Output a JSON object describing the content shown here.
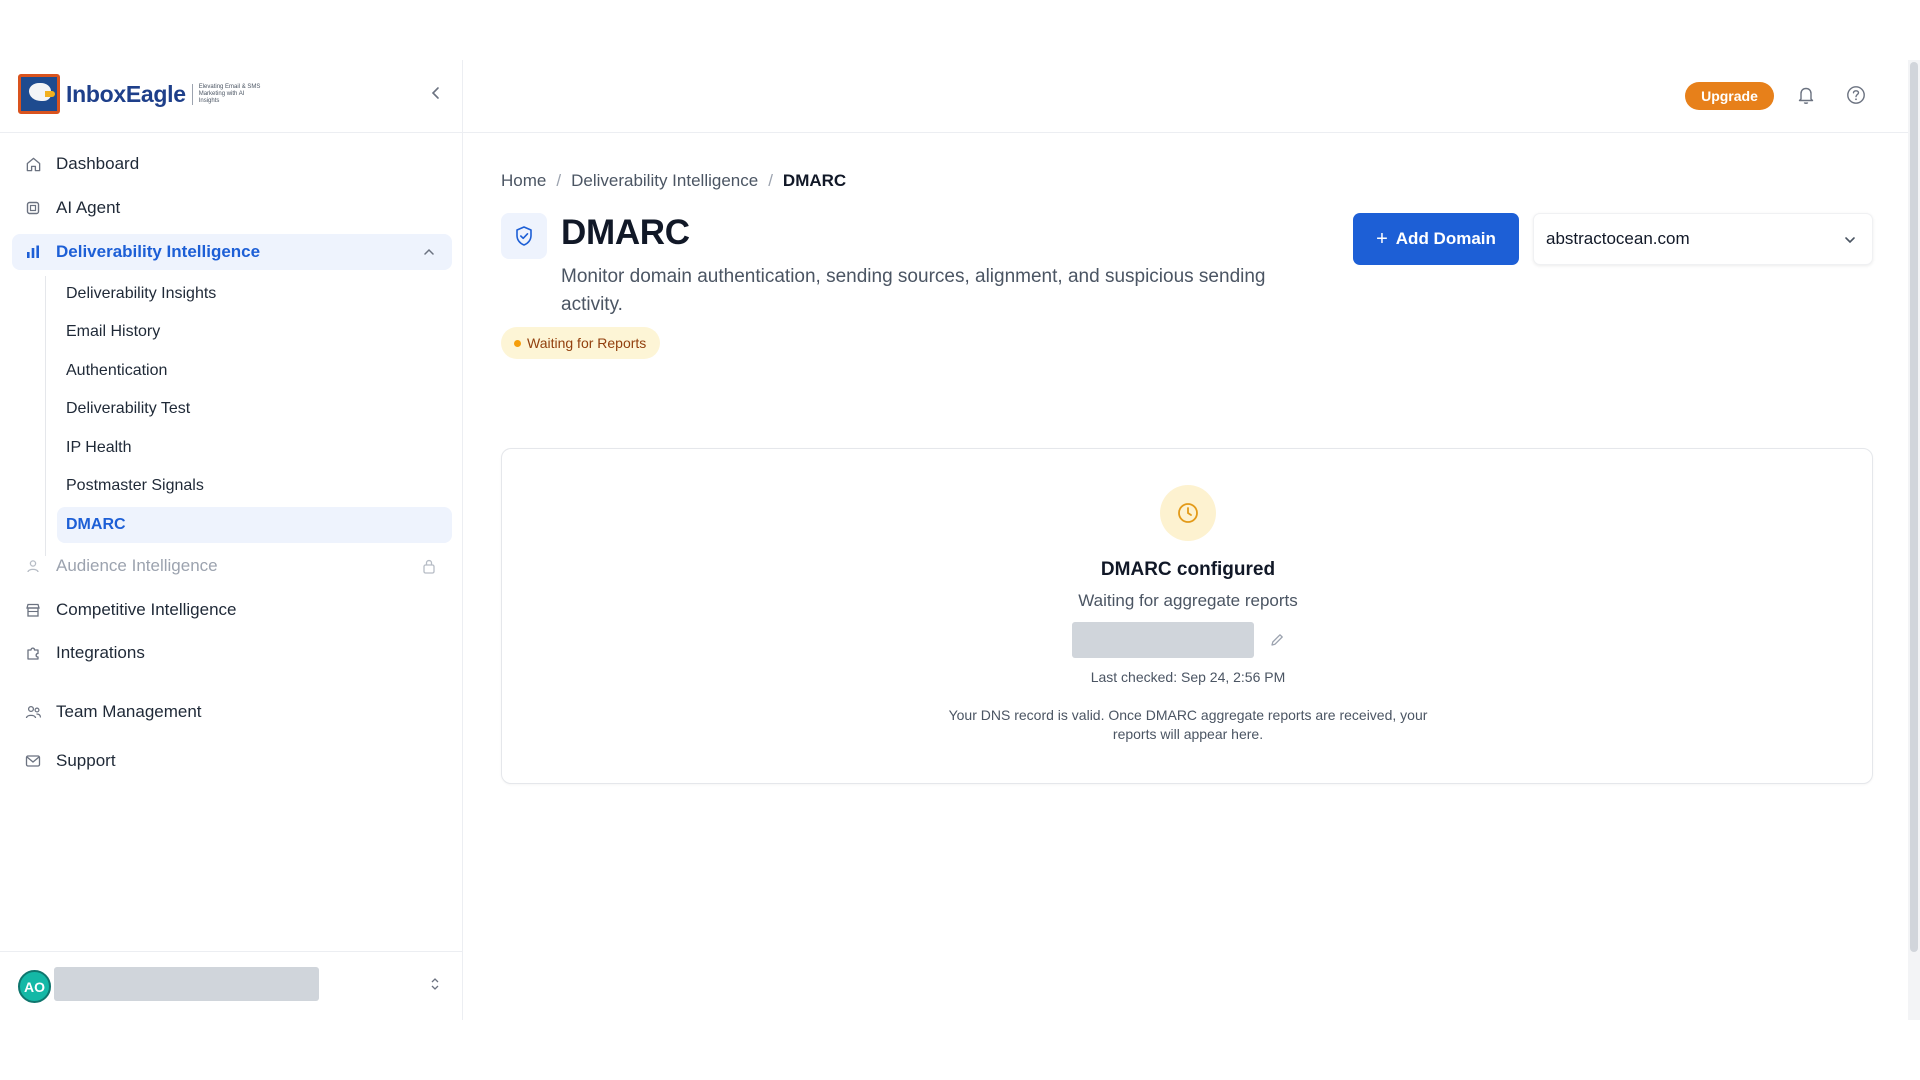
{
  "brand": {
    "name": "InboxEagle",
    "tagline": "Elevating Email & SMS Marketing with AI Insights"
  },
  "topbar": {
    "upgrade_label": "Upgrade",
    "icons": [
      "bell-icon",
      "help-icon"
    ]
  },
  "sidebar": {
    "items": [
      {
        "label": "Dashboard",
        "icon": "home-icon"
      },
      {
        "label": "AI Agent",
        "icon": "chip-icon"
      },
      {
        "label": "Deliverability Intelligence",
        "icon": "bar-chart-icon",
        "expanded": true
      },
      {
        "label": "Audience Intelligence",
        "icon": "users-icon",
        "locked": true
      },
      {
        "label": "Competitive Intelligence",
        "icon": "store-icon"
      },
      {
        "label": "Integrations",
        "icon": "puzzle-icon"
      },
      {
        "label": "Team Management",
        "icon": "team-icon"
      },
      {
        "label": "Support",
        "icon": "mail-icon"
      }
    ],
    "sub_items": [
      {
        "label": "Deliverability Insights"
      },
      {
        "label": "Email History"
      },
      {
        "label": "Authentication"
      },
      {
        "label": "Deliverability Test"
      },
      {
        "label": "IP Health"
      },
      {
        "label": "Postmaster Signals"
      },
      {
        "label": "DMARC",
        "active": true
      }
    ],
    "user": {
      "initials": "AO"
    }
  },
  "breadcrumb": {
    "home": "Home",
    "section": "Deliverability Intelligence",
    "current": "DMARC"
  },
  "page": {
    "title": "DMARC",
    "description": "Monitor domain authentication, sending sources, alignment, and suspicious sending activity.",
    "status": "Waiting for Reports",
    "add_domain_label": "Add Domain",
    "selected_domain": "abstractocean.com"
  },
  "card": {
    "title": "DMARC configured",
    "subtitle": "Waiting for aggregate reports",
    "last_checked": "Last checked: Sep 24, 2:56 PM",
    "note": "Your DNS record is valid. Once DMARC aggregate reports are received, your reports will appear here."
  },
  "colors": {
    "accent": "#1d5fd6",
    "upgrade": "#e7801a",
    "status_bg": "#fdf5d6",
    "status_dot": "#f59e0b"
  }
}
